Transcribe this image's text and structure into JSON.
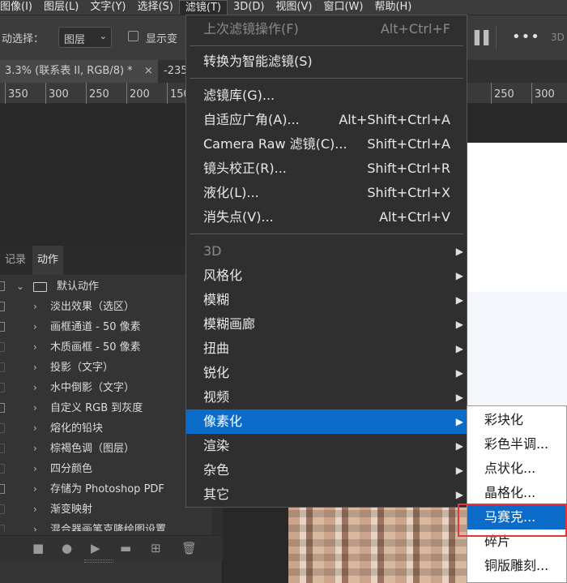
{
  "menubar": {
    "items": [
      "图像(I)",
      "图层(L)",
      "文字(Y)",
      "选择(S)",
      "滤镜(T)",
      "3D(D)",
      "视图(V)",
      "窗口(W)",
      "帮助(H)"
    ],
    "active_index": 4
  },
  "options": {
    "auto_select_label": "动选择：",
    "select_value": "图层",
    "show_transform_label": "显示变",
    "extra_3d": "3D"
  },
  "doc_tabs": [
    {
      "label": "3.3% (联系表 II, RGB/8) *",
      "close": "×"
    },
    {
      "label": "-235",
      "close": ""
    }
  ],
  "ruler": {
    "ticks": [
      "350",
      "300",
      "250",
      "200",
      "150"
    ],
    "right_ticks": [
      "250",
      "300"
    ]
  },
  "panel": {
    "tabs": [
      "记录",
      "动作"
    ],
    "active_tab_index": 1,
    "set_name": "默认动作",
    "actions": [
      "淡出效果（选区）",
      "画框通道 - 50 像素",
      "木质画框 - 50 像素",
      "投影（文字）",
      "水中倒影（文字）",
      "自定义 RGB 到灰度",
      "熔化的铅块",
      "棕褐色调（图层）",
      "四分颜色",
      "存储为 Photoshop PDF",
      "渐变映射",
      "混合器画笔克隆绘图设置"
    ]
  },
  "filter_menu": {
    "last_filter": {
      "label": "上次滤镜操作(F)",
      "shortcut": "Alt+Ctrl+F"
    },
    "convert_smart": "转换为智能滤镜(S)",
    "group2": [
      {
        "label": "滤镜库(G)...",
        "shortcut": ""
      },
      {
        "label": "自适应广角(A)...",
        "shortcut": "Alt+Shift+Ctrl+A"
      },
      {
        "label": "Camera Raw 滤镜(C)...",
        "shortcut": "Shift+Ctrl+A"
      },
      {
        "label": "镜头校正(R)...",
        "shortcut": "Shift+Ctrl+R"
      },
      {
        "label": "液化(L)...",
        "shortcut": "Shift+Ctrl+X"
      },
      {
        "label": "消失点(V)...",
        "shortcut": "Alt+Ctrl+V"
      }
    ],
    "submenus": [
      "3D",
      "风格化",
      "模糊",
      "模糊画廊",
      "扭曲",
      "锐化",
      "视频",
      "像素化",
      "渲染",
      "杂色",
      "其它"
    ],
    "highlighted": "像素化",
    "submenu_arrow": "▶"
  },
  "pixelate_submenu": {
    "items": [
      "彩块化",
      "彩色半调...",
      "点状化...",
      "晶格化...",
      "马赛克...",
      "碎片",
      "铜版雕刻..."
    ],
    "highlighted_index": 4
  },
  "colors": {
    "highlight": "#0b6bc9",
    "annotation_box": "#e8343f"
  }
}
